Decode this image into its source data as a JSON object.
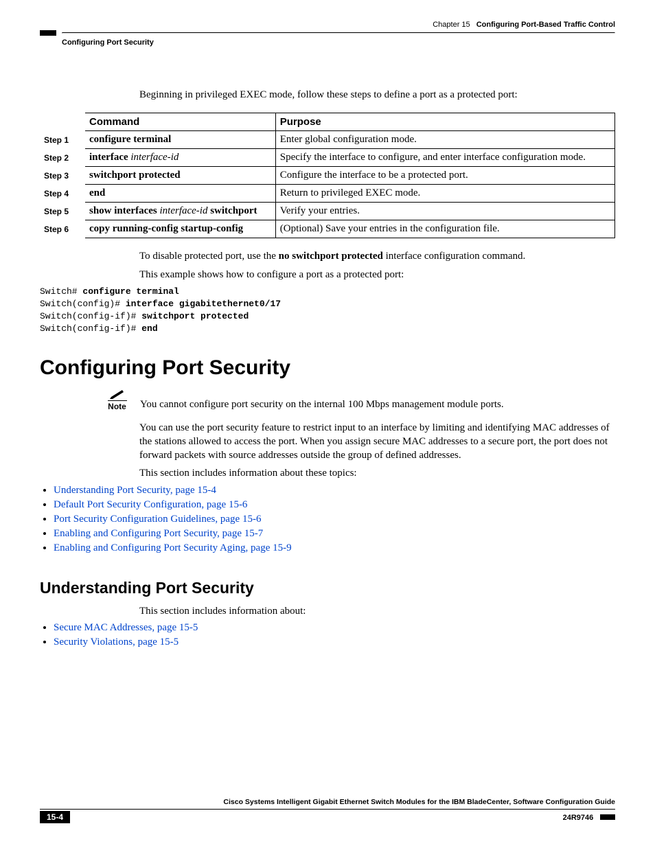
{
  "header": {
    "chapter_prefix": "Chapter 15",
    "chapter_title": "Configuring Port-Based Traffic Control",
    "section": "Configuring Port Security"
  },
  "intro": "Beginning in privileged EXEC mode, follow these steps to define a port as a protected port:",
  "table": {
    "headers": {
      "command": "Command",
      "purpose": "Purpose"
    },
    "rows": [
      {
        "step": "Step 1",
        "command_html": "<span class='b'>configure terminal</span>",
        "purpose": "Enter global configuration mode."
      },
      {
        "step": "Step 2",
        "command_html": "<span class='b'>interface</span> <span class='i'>interface-id</span>",
        "purpose": "Specify the interface to configure, and enter interface configuration mode."
      },
      {
        "step": "Step 3",
        "command_html": "<span class='b'>switchport protected</span>",
        "purpose": "Configure the interface to be a protected port."
      },
      {
        "step": "Step 4",
        "command_html": "<span class='b'>end</span>",
        "purpose": "Return to privileged EXEC mode."
      },
      {
        "step": "Step 5",
        "command_html": "<span class='b'>show interfaces</span> <span class='i'>interface-id</span> <span class='b'>switchport</span>",
        "purpose": "Verify your entries."
      },
      {
        "step": "Step 6",
        "command_html": "<span class='b'>copy running-config startup-config</span>",
        "purpose": "(Optional) Save your entries in the configuration file."
      }
    ]
  },
  "after_table": {
    "disable_html": "To disable protected port, use the <span class='b'>no switchport protected</span> interface configuration command.",
    "example_intro": "This example shows how to configure a port as a protected port:",
    "code_html": "Switch# <b>configure terminal</b>\nSwitch(config)# <b>interface gigabitethernet0/17</b>\nSwitch(config-if)# <b>switchport protected</b>\nSwitch(config-if)# <b>end</b>"
  },
  "section1": {
    "title": "Configuring Port Security",
    "note_label": "Note",
    "note_text": "You cannot configure port security on the internal 100 Mbps management module ports.",
    "p1": "You can use the port security feature to restrict input to an interface by limiting and identifying MAC addresses of the stations allowed to access the port. When you assign secure MAC addresses to a secure port, the port does not forward packets with source addresses outside the group of defined addresses.",
    "p2": "This section includes information about these topics:",
    "links": [
      "Understanding Port Security, page 15-4",
      "Default Port Security Configuration, page 15-6",
      "Port Security Configuration Guidelines, page 15-6",
      "Enabling and Configuring Port Security, page 15-7",
      "Enabling and Configuring Port Security Aging, page 15-9"
    ]
  },
  "section2": {
    "title": "Understanding Port Security",
    "p1": "This section includes information about:",
    "links": [
      "Secure MAC Addresses, page 15-5",
      "Security Violations, page 15-5"
    ]
  },
  "footer": {
    "title": "Cisco Systems Intelligent Gigabit Ethernet Switch Modules for the IBM BladeCenter, Software Configuration Guide",
    "page": "15-4",
    "docid": "24R9746"
  }
}
